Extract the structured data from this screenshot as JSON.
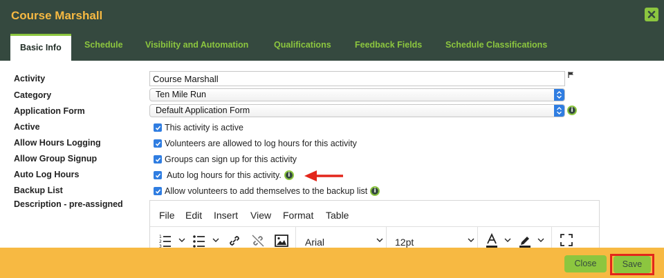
{
  "dialog": {
    "title": "Course Marshall"
  },
  "tabs": [
    {
      "label": "Basic Info"
    },
    {
      "label": "Schedule"
    },
    {
      "label": "Visibility and Automation"
    },
    {
      "label": "Qualifications"
    },
    {
      "label": "Feedback Fields"
    },
    {
      "label": "Schedule Classifications"
    }
  ],
  "form": {
    "labels": [
      "Activity",
      "Category",
      "Application Form",
      "Active",
      "Allow Hours Logging",
      "Allow Group Signup",
      "Auto Log Hours",
      "Backup List",
      "Description - pre-assigned"
    ],
    "activity_value": "Course Marshall",
    "category_value": "Ten Mile Run",
    "application_form_value": "Default Application Form",
    "checkboxes": [
      {
        "label": "This activity is active",
        "checked": true
      },
      {
        "label": "Volunteers are allowed to log hours for this activity",
        "checked": true
      },
      {
        "label": "Groups can sign up for this activity",
        "checked": true
      },
      {
        "label": "Auto log hours for this activity.",
        "checked": true
      },
      {
        "label": "Allow volunteers to add themselves to the backup list",
        "checked": true
      }
    ]
  },
  "editor": {
    "menu": [
      "File",
      "Edit",
      "Insert",
      "View",
      "Format",
      "Table"
    ],
    "font_family": "Arial",
    "font_size": "12pt"
  },
  "footer": {
    "close_label": "Close",
    "save_label": "Save"
  },
  "icons": {
    "info": "info-icon",
    "flag": "flag-icon",
    "close": "close-icon",
    "annotation": "red-arrow-icon"
  },
  "colors": {
    "header_bg": "#35493f",
    "title": "#f7b942",
    "accent_green": "#8cc63f",
    "footer_bg": "#f7b942",
    "checkbox_blue": "#2f7de1",
    "highlight_red": "#e3261b"
  }
}
